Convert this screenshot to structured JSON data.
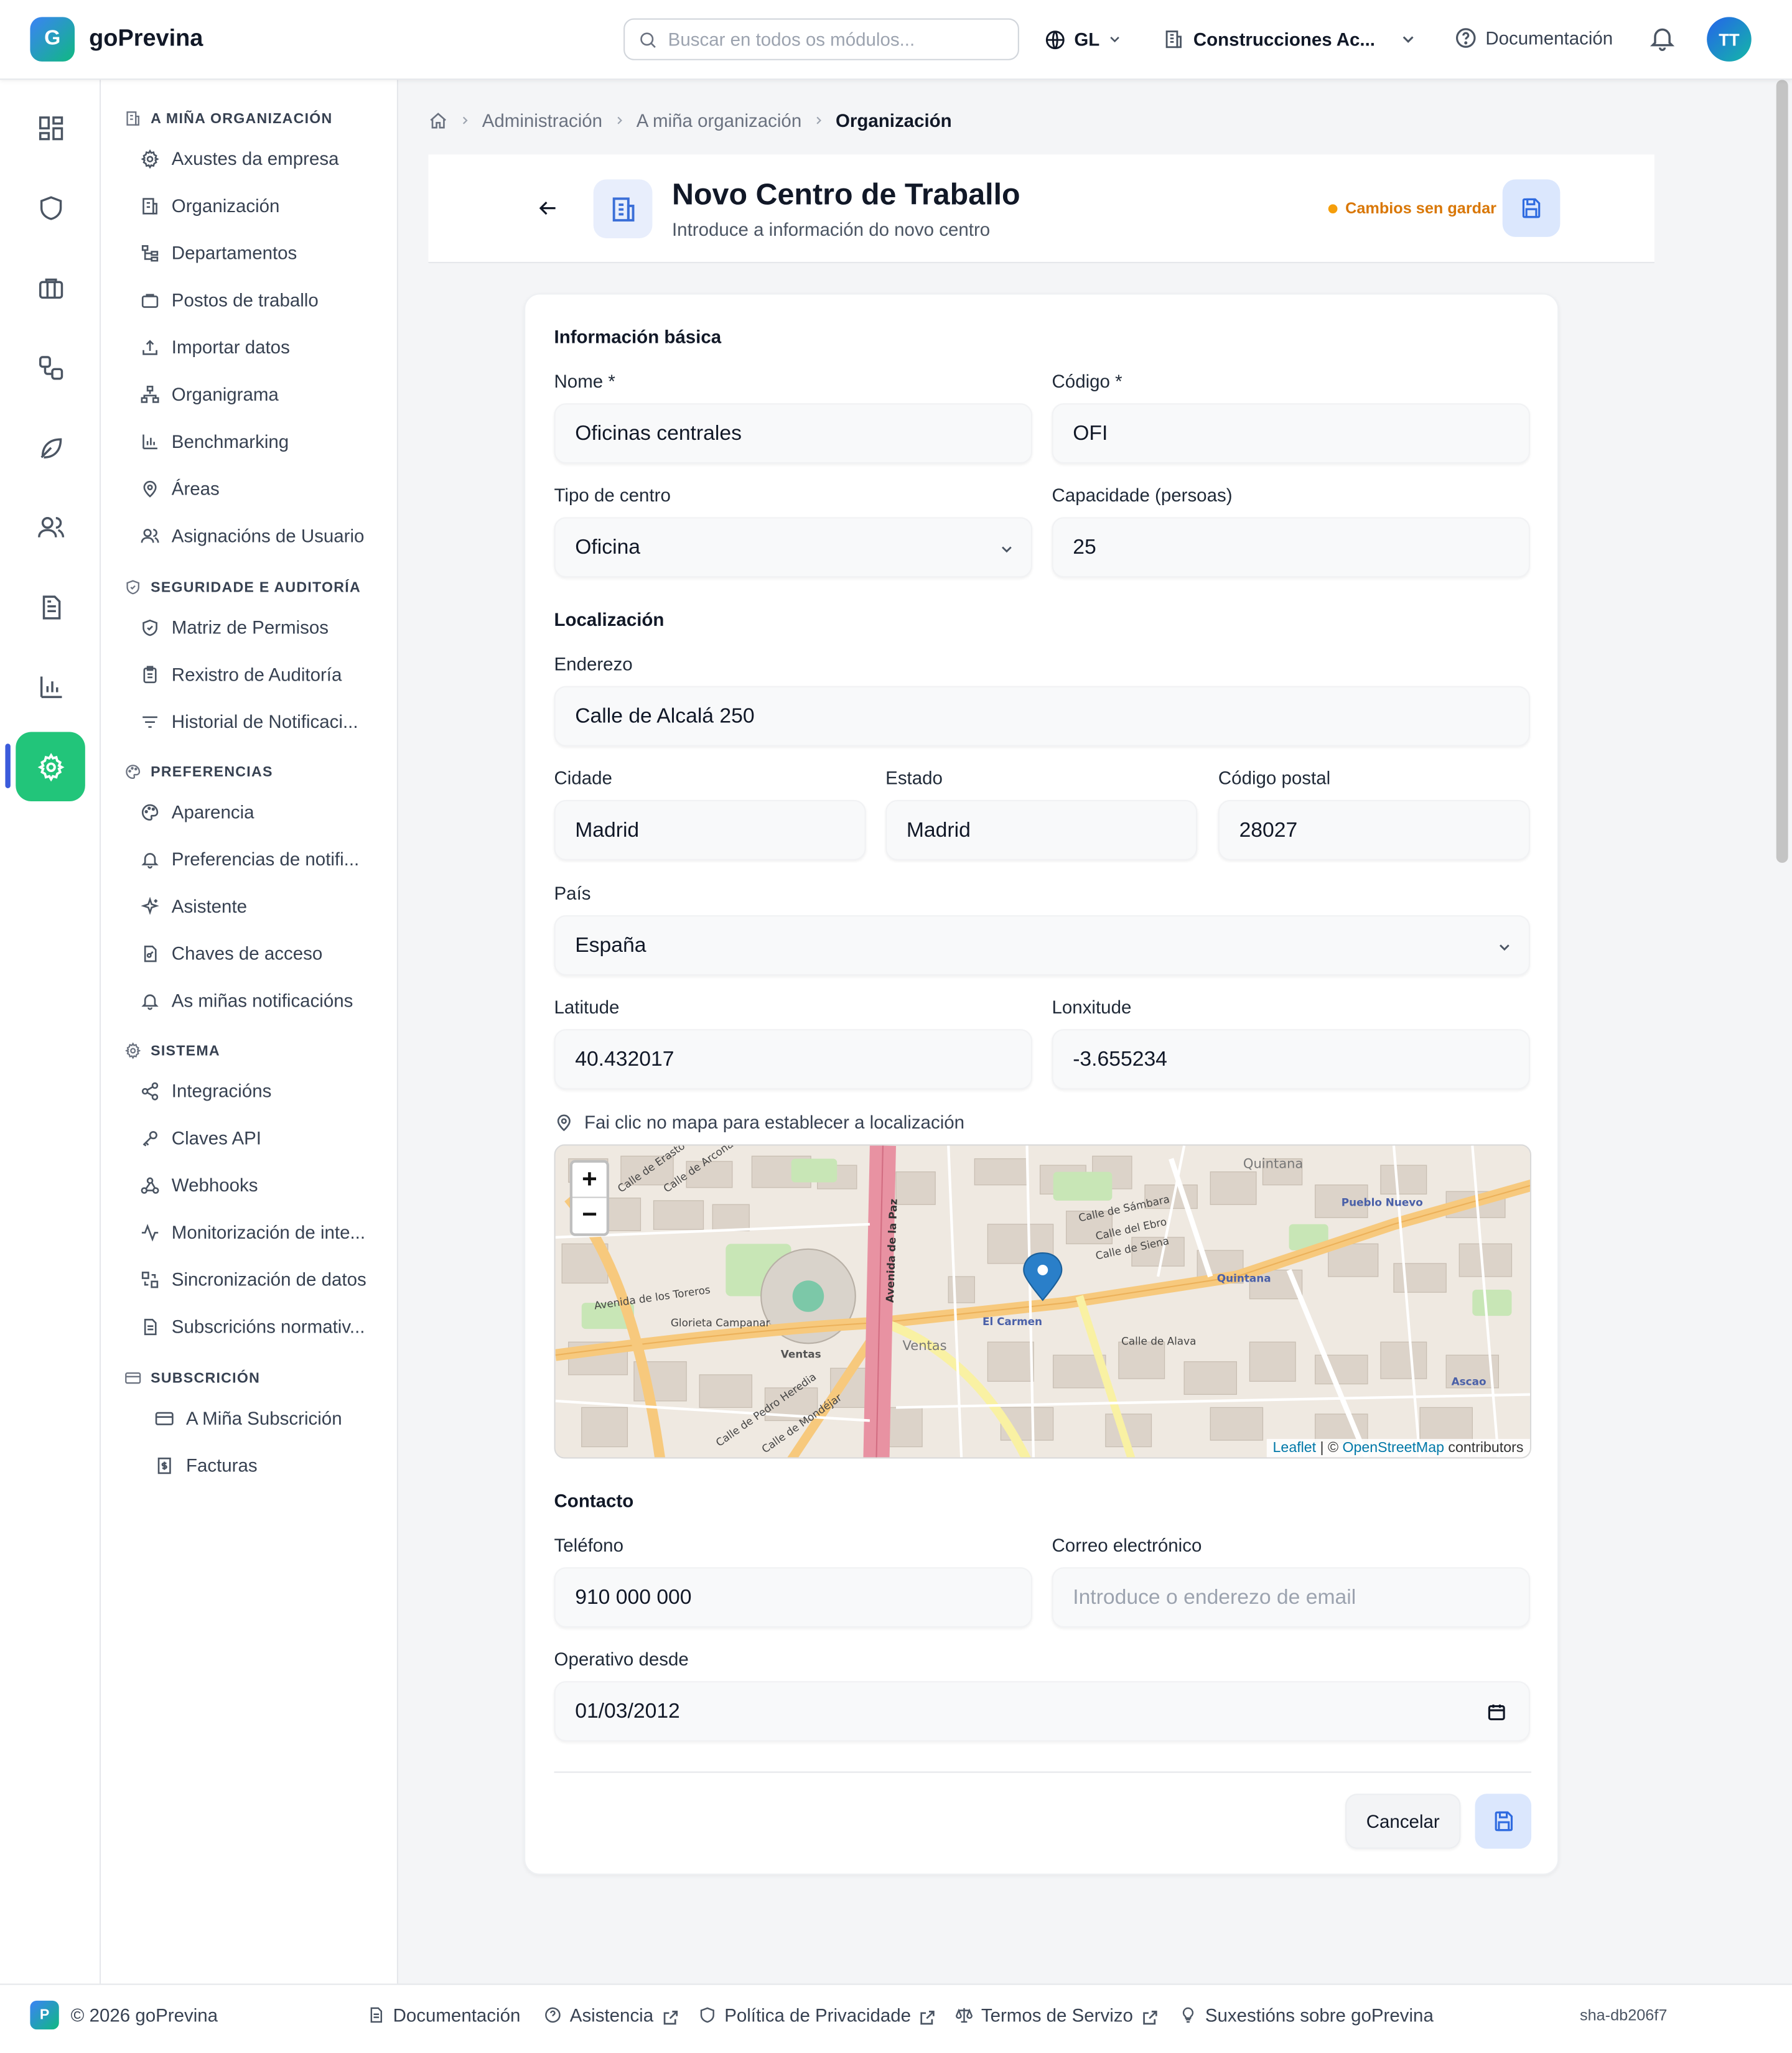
{
  "app": {
    "logo_letter": "G",
    "name": "goPrevina"
  },
  "topbar": {
    "search_placeholder": "Buscar en todos os módulos...",
    "language": "GL",
    "company": "Construcciones Ac...",
    "docs_label": "Documentación",
    "avatar_initials": "TT"
  },
  "rail": {
    "items": [
      "dashboard-icon",
      "shield-icon",
      "briefcase-icon",
      "workflow-icon",
      "leaf-icon",
      "users-icon",
      "document-icon",
      "bar-chart-icon",
      "settings-icon"
    ],
    "active_index": 8,
    "active_color": "#22c57a"
  },
  "sidebar": {
    "sections": [
      {
        "title": "A MIÑA ORGANIZACIÓN",
        "icon": "building-icon",
        "items": [
          {
            "label": "Axustes da empresa",
            "icon": "gear-icon"
          },
          {
            "label": "Organización",
            "icon": "building-icon"
          },
          {
            "label": "Departamentos",
            "icon": "hierarchy-icon"
          },
          {
            "label": "Postos de traballo",
            "icon": "briefcase-icon"
          },
          {
            "label": "Importar datos",
            "icon": "upload-icon"
          },
          {
            "label": "Organigrama",
            "icon": "network-icon"
          },
          {
            "label": "Benchmarking",
            "icon": "bar-chart-icon"
          },
          {
            "label": "Áreas",
            "icon": "map-pin-icon"
          },
          {
            "label": "Asignacións de Usuario",
            "icon": "users-icon"
          }
        ]
      },
      {
        "title": "SEGURIDADE E AUDITORÍA",
        "icon": "shield-check-icon",
        "items": [
          {
            "label": "Matriz de Permisos",
            "icon": "shield-check-icon"
          },
          {
            "label": "Rexistro de Auditoría",
            "icon": "clipboard-icon"
          },
          {
            "label": "Historial de Notificaci...",
            "icon": "filter-icon"
          }
        ]
      },
      {
        "title": "PREFERENCIAS",
        "icon": "palette-icon",
        "items": [
          {
            "label": "Aparencia",
            "icon": "palette-icon"
          },
          {
            "label": "Preferencias de notifi...",
            "icon": "bell-icon"
          },
          {
            "label": "Asistente",
            "icon": "sparkles-icon"
          },
          {
            "label": "Chaves de acceso",
            "icon": "file-key-icon"
          },
          {
            "label": "As miñas notificacións",
            "icon": "bell-icon"
          }
        ]
      },
      {
        "title": "SISTEMA",
        "icon": "gear-icon",
        "items": [
          {
            "label": "Integracións",
            "icon": "share-icon"
          },
          {
            "label": "Claves API",
            "icon": "key-icon"
          },
          {
            "label": "Webhooks",
            "icon": "webhook-icon"
          },
          {
            "label": "Monitorización de inte...",
            "icon": "activity-icon"
          },
          {
            "label": "Sincronización de datos",
            "icon": "sync-icon"
          },
          {
            "label": "Subscricións normativ...",
            "icon": "document-icon"
          }
        ]
      },
      {
        "title": "SUBSCRICIÓN",
        "icon": "credit-card-icon",
        "items": [
          {
            "label": "A Miña Subscrición",
            "icon": "credit-card-icon"
          },
          {
            "label": "Facturas",
            "icon": "receipt-icon"
          }
        ]
      }
    ]
  },
  "breadcrumb": {
    "items": [
      "Administración",
      "A miña organización"
    ],
    "current": "Organización"
  },
  "header": {
    "title": "Novo Centro de Traballo",
    "subtitle": "Introduce a información do novo centro",
    "unsaved": "Cambios sen gardar",
    "unsaved_color": "#d97706"
  },
  "form": {
    "basic_title": "Información básica",
    "name_label": "Nome *",
    "name_value": "Oficinas centrales",
    "code_label": "Código *",
    "code_value": "OFI",
    "type_label": "Tipo de centro",
    "type_value": "Oficina",
    "capacity_label": "Capacidade (persoas)",
    "capacity_value": "25",
    "location_title": "Localización",
    "address_label": "Enderezo",
    "address_value": "Calle de Alcalá 250",
    "city_label": "Cidade",
    "city_value": "Madrid",
    "state_label": "Estado",
    "state_value": "Madrid",
    "postal_label": "Código postal",
    "postal_value": "28027",
    "country_label": "País",
    "country_value": "España",
    "lat_label": "Latitude",
    "lat_value": "40.432017",
    "lon_label": "Lonxitude",
    "lon_value": "-3.655234",
    "map_hint": "Fai clic no mapa para establecer a localización",
    "contact_title": "Contacto",
    "phone_label": "Teléfono",
    "phone_value": "910 000 000",
    "email_label": "Correo electrónico",
    "email_placeholder": "Introduce o enderezo de email",
    "since_label": "Operativo desde",
    "since_value": "01/03/2012",
    "cancel_label": "Cancelar"
  },
  "map": {
    "zoom_in": "+",
    "zoom_out": "−",
    "attrib_leaflet": "Leaflet",
    "attrib_sep": " | © ",
    "attrib_osm": "OpenStreetMap",
    "attrib_tail": " contributors",
    "labels": [
      "Avenida de los Toreros",
      "Glorieta Campanar",
      "Ventas",
      "Ventas",
      "Avenida de la Paz",
      "El Carmen",
      "Calle de Alava",
      "Quintana",
      "Quintana",
      "Pueblo Nuevo",
      "Ascao",
      "Calle de Siena",
      "Calle del Ebro",
      "Calle de Sámbara",
      "Calle de Pedro Heredia",
      "Calle de Mondéjar",
      "Calle de Arcona",
      "Calle de Erasto"
    ]
  },
  "footer": {
    "logo_letter": "P",
    "copyright": "© 2026 goPrevina",
    "links": [
      {
        "label": "Documentación",
        "icon": "document-icon"
      },
      {
        "label": "Asistencia",
        "icon": "help-icon"
      },
      {
        "label": "Política de Privacidade",
        "icon": "shield-icon"
      },
      {
        "label": "Termos de Servizo",
        "icon": "scale-icon"
      },
      {
        "label": "Suxestións sobre goPrevina",
        "icon": "lightbulb-icon"
      }
    ],
    "version": "sha-db206f7"
  }
}
